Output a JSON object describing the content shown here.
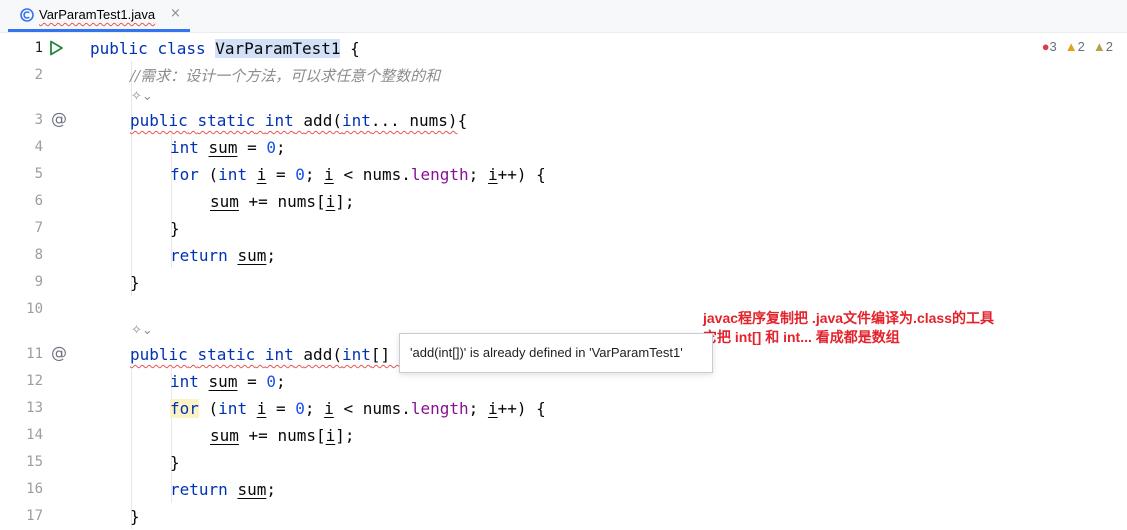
{
  "tab": {
    "label": "VarParamTest1.java",
    "close": "×"
  },
  "inspections": {
    "errors": "3",
    "warnings": "2",
    "weak_warnings": "2"
  },
  "gutter": {
    "lines": [
      "1",
      "2",
      "3",
      "4",
      "5",
      "6",
      "7",
      "8",
      "9",
      "10",
      "11",
      "12",
      "13",
      "14",
      "15",
      "16",
      "17"
    ]
  },
  "code": {
    "l1": {
      "kw1": "public",
      "kw2": "class",
      "name": "VarParamTest1",
      "rest": " {"
    },
    "l2": {
      "comment": "//需求：设计一个方法，可以求任意个整数的和"
    },
    "l3": {
      "kw1": "public",
      "kw2": "static",
      "kw3": "int",
      "sig": "add(",
      "kw4": "int",
      "rest": "... nums)",
      "brace": "{"
    },
    "l4": {
      "kw": "int",
      "var": "sum",
      "op": " = ",
      "num": "0",
      "end": ";"
    },
    "l5": {
      "kw": "for",
      "p1": " (",
      "kw2": "int",
      "var1": "i",
      "op1": " = ",
      "num": "0",
      "sep1": "; ",
      "var2": "i",
      "op2": " < nums.",
      "fld": "length",
      "sep2": "; ",
      "var3": "i",
      "inc": "++) {"
    },
    "l6": {
      "var": "sum",
      "rest": " += nums[",
      "var2": "i",
      "end": "];"
    },
    "l7": {
      "text": "}"
    },
    "l8": {
      "kw": "return",
      "var": "sum",
      "end": ";"
    },
    "l9": {
      "text": "}"
    },
    "l11": {
      "kw1": "public",
      "kw2": "static",
      "kw3": "int",
      "sig": "add(",
      "kw4": "int",
      "rest": "[] nums)",
      "brace": "{"
    },
    "l12": {
      "kw": "int",
      "var": "sum",
      "op": " = ",
      "num": "0",
      "end": ";"
    },
    "l13": {
      "kw": "for",
      "p1": " (",
      "kw2": "int",
      "var1": "i",
      "op1": " = ",
      "num": "0",
      "sep1": "; ",
      "var2": "i",
      "op2": " < nums.",
      "fld": "length",
      "sep2": "; ",
      "var3": "i",
      "inc": "++) {"
    },
    "l14": {
      "var": "sum",
      "rest": " += nums[",
      "var2": "i",
      "end": "];"
    },
    "l15": {
      "text": "}"
    },
    "l16": {
      "kw": "return",
      "var": "sum",
      "end": ";"
    },
    "l17": {
      "text": "}"
    }
  },
  "tooltip": {
    "text": "'add(int[])' is already defined in 'VarParamTest1'"
  },
  "annotation": {
    "line1": "javac程序复制把 .java文件编译为.class的工具",
    "line2": "它把 int[] 和 int... 看成都是数组"
  },
  "colors": {
    "error": "#e55757",
    "keyword": "#0033b3",
    "accent": "#3574f0",
    "annotation": "#e3232c"
  }
}
